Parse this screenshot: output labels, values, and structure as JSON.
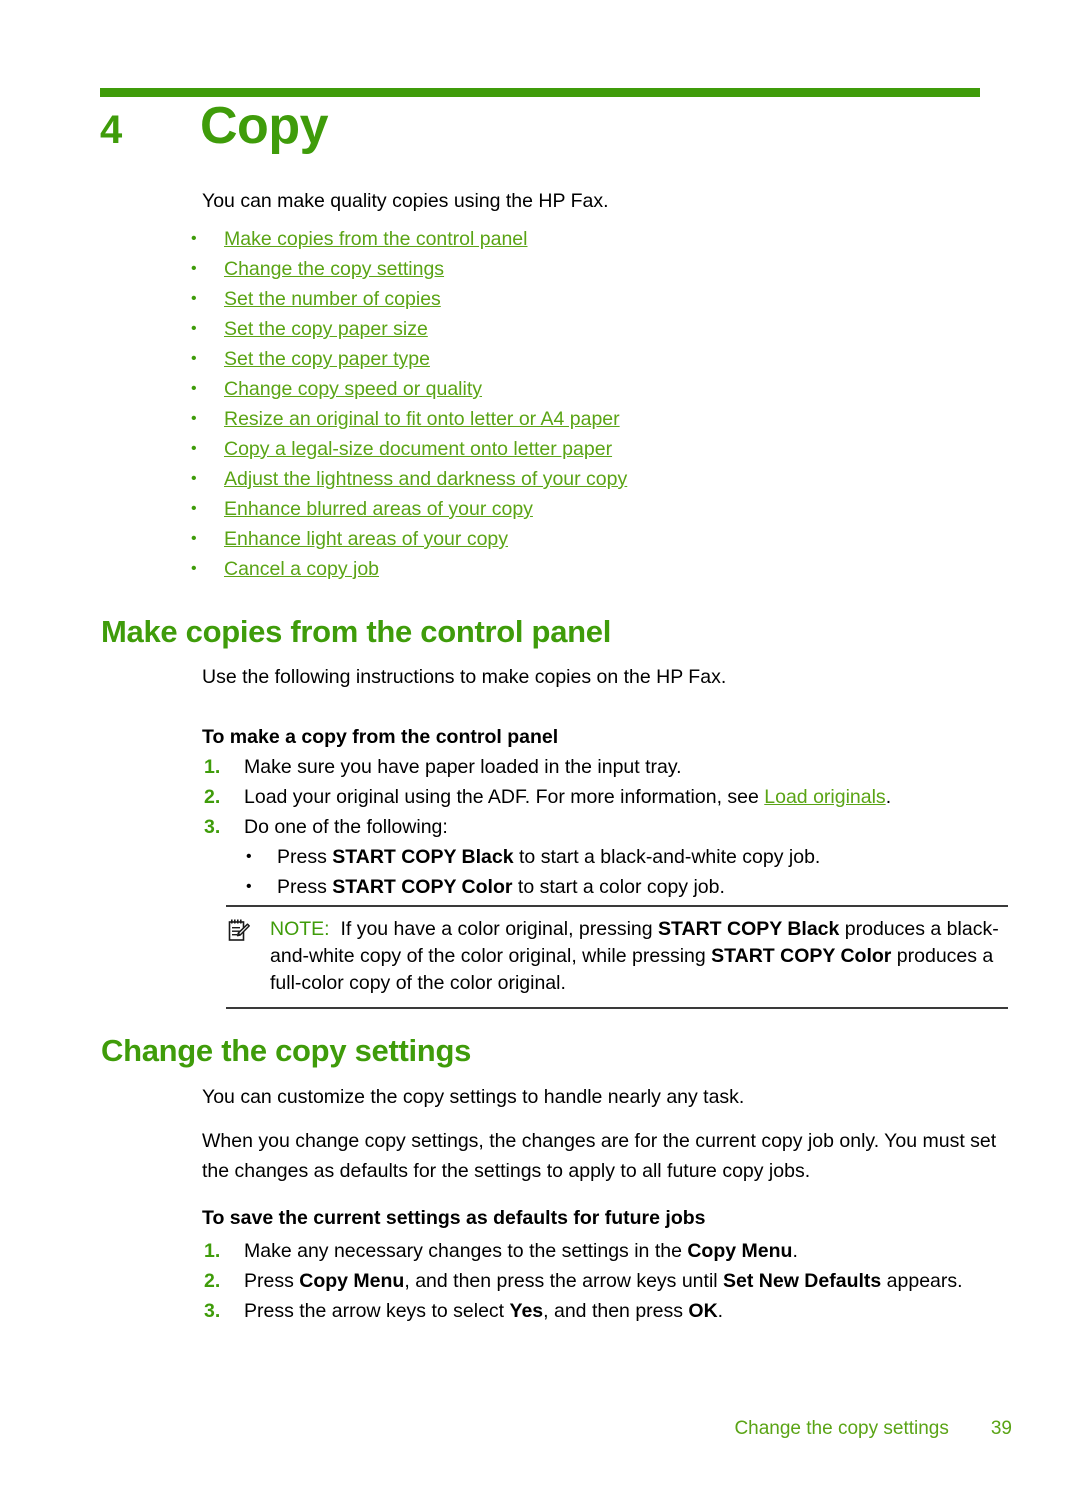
{
  "colors": {
    "green_heading": "#3f9c0a",
    "green_link": "#5aa415",
    "rule_dark": "#3a3a3a",
    "text": "#000000"
  },
  "chapter": {
    "number": "4",
    "title": "Copy",
    "intro": "You can make quality copies using the HP Fax."
  },
  "toc": {
    "items": [
      "Make copies from the control panel",
      "Change the copy settings",
      "Set the number of copies",
      "Set the copy paper size",
      "Set the copy paper type",
      "Change copy speed or quality",
      "Resize an original to fit onto letter or A4 paper",
      "Copy a legal-size document onto letter paper",
      "Adjust the lightness and darkness of your copy",
      "Enhance blurred areas of your copy",
      "Enhance light areas of your copy",
      "Cancel a copy job"
    ]
  },
  "section1": {
    "heading": "Make copies from the control panel",
    "intro": "Use the following instructions to make copies on the HP Fax.",
    "subhead": "To make a copy from the control panel",
    "step1": "Make sure you have paper loaded in the input tray.",
    "step2_pre": "Load your original using the ADF. For more information, see ",
    "step2_link": "Load originals",
    "step2_post": ".",
    "step3": "Do one of the following:",
    "sub1_pre": "Press ",
    "sub1_bold": "START COPY Black",
    "sub1_post": " to start a black-and-white copy job.",
    "sub2_pre": "Press ",
    "sub2_bold": "START COPY Color",
    "sub2_post": " to start a color copy job."
  },
  "note": {
    "icon": "note-pad-pencil-icon",
    "label": "NOTE:",
    "text_1": "If you have a color original, pressing ",
    "bold_1": "START COPY Black",
    "text_2": " produces a black-and-white copy of the color original, while pressing ",
    "bold_2": "START COPY Color",
    "text_3": " produces a full-color copy of the color original."
  },
  "section2": {
    "heading": "Change the copy settings",
    "para1": "You can customize the copy settings to handle nearly any task.",
    "para2": "When you change copy settings, the changes are for the current copy job only. You must set the changes as defaults for the settings to apply to all future copy jobs.",
    "subhead": "To save the current settings as defaults for future jobs",
    "step1_pre": "Make any necessary changes to the settings in the ",
    "step1_bold": "Copy Menu",
    "step1_post": ".",
    "step2_pre": "Press ",
    "step2_bold_a": "Copy Menu",
    "step2_mid": ", and then press the arrow keys until ",
    "step2_bold_b": "Set New Defaults",
    "step2_post": " appears.",
    "step3_pre": "Press the arrow keys to select ",
    "step3_bold_a": "Yes",
    "step3_mid": ", and then press ",
    "step3_bold_b": "OK",
    "step3_post": "."
  },
  "footer": {
    "title": "Change the copy settings",
    "page": "39"
  }
}
